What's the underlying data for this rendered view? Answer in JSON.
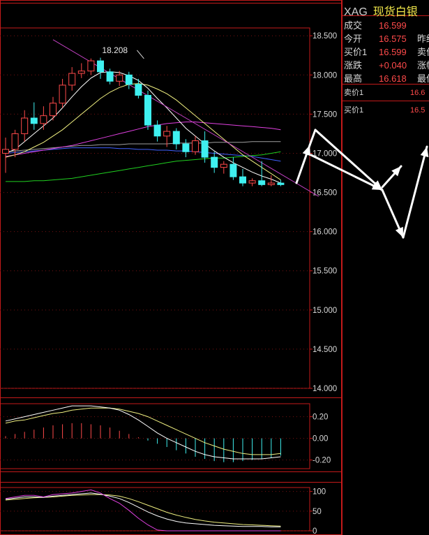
{
  "quote": {
    "code": "XAG",
    "name": "现货白银",
    "rows": [
      {
        "label": "成交",
        "value": "16.599",
        "label2": ""
      },
      {
        "label": "今开",
        "value": "16.575",
        "label2": "昨结"
      },
      {
        "label": "买价1",
        "value": "16.599",
        "label2": "卖价"
      },
      {
        "label": "涨跌",
        "value": "+0.040",
        "label2": "涨幅"
      },
      {
        "label": "最高",
        "value": "16.618",
        "label2": "最低"
      }
    ],
    "sell1": {
      "label": "卖价1",
      "value": "16.6"
    },
    "buy1": {
      "label": "买价1",
      "value": "16.5"
    }
  },
  "chart_data": [
    {
      "type": "candlestick",
      "panel": "main",
      "ylim": [
        14.0,
        18.6
      ],
      "y_ticks": [
        "18.500",
        "18.000",
        "17.500",
        "17.000",
        "16.500",
        "16.000",
        "15.500",
        "15.000",
        "14.500",
        "14.000"
      ],
      "y_tick_values": [
        18.5,
        18.0,
        17.5,
        17.0,
        16.5,
        16.0,
        15.5,
        15.0,
        14.5,
        14.0
      ],
      "annotation": {
        "text": "18.208",
        "index": 14,
        "value": 18.208
      },
      "colors": {
        "up": "#ff4a4a",
        "down": "#3ff0f0",
        "ma_short": "#ffffff",
        "ma_mid": "#f0f080",
        "ma_long1": "#e040e0",
        "ma_long2": "#4060ff",
        "ma_long3": "#20d020",
        "ma_long4": "#a0a0a0",
        "trend": "#c040c0"
      },
      "candles": [
        {
          "o": 17.0,
          "h": 17.2,
          "l": 16.75,
          "c": 17.05
        },
        {
          "o": 17.05,
          "h": 17.3,
          "l": 16.95,
          "c": 17.25
        },
        {
          "o": 17.25,
          "h": 17.55,
          "l": 17.15,
          "c": 17.45
        },
        {
          "o": 17.45,
          "h": 17.65,
          "l": 17.3,
          "c": 17.38
        },
        {
          "o": 17.38,
          "h": 17.6,
          "l": 17.3,
          "c": 17.48
        },
        {
          "o": 17.48,
          "h": 17.72,
          "l": 17.42,
          "c": 17.64
        },
        {
          "o": 17.64,
          "h": 17.95,
          "l": 17.58,
          "c": 17.87
        },
        {
          "o": 17.87,
          "h": 18.1,
          "l": 17.8,
          "c": 18.02
        },
        {
          "o": 18.02,
          "h": 18.15,
          "l": 17.96,
          "c": 18.05
        },
        {
          "o": 18.05,
          "h": 18.21,
          "l": 18.0,
          "c": 18.18
        },
        {
          "o": 18.18,
          "h": 18.22,
          "l": 17.95,
          "c": 18.04
        },
        {
          "o": 18.04,
          "h": 18.08,
          "l": 17.88,
          "c": 17.92
        },
        {
          "o": 17.92,
          "h": 18.05,
          "l": 17.86,
          "c": 18.0
        },
        {
          "o": 18.0,
          "h": 18.04,
          "l": 17.82,
          "c": 17.88
        },
        {
          "o": 17.88,
          "h": 17.95,
          "l": 17.7,
          "c": 17.74
        },
        {
          "o": 17.74,
          "h": 17.8,
          "l": 17.3,
          "c": 17.36
        },
        {
          "o": 17.36,
          "h": 17.42,
          "l": 17.15,
          "c": 17.22
        },
        {
          "o": 17.22,
          "h": 17.35,
          "l": 17.08,
          "c": 17.28
        },
        {
          "o": 17.28,
          "h": 17.32,
          "l": 17.05,
          "c": 17.12
        },
        {
          "o": 17.12,
          "h": 17.18,
          "l": 16.95,
          "c": 17.02
        },
        {
          "o": 17.02,
          "h": 17.22,
          "l": 16.98,
          "c": 17.16
        },
        {
          "o": 17.16,
          "h": 17.28,
          "l": 16.88,
          "c": 16.95
        },
        {
          "o": 16.95,
          "h": 17.02,
          "l": 16.75,
          "c": 16.82
        },
        {
          "o": 16.82,
          "h": 16.9,
          "l": 16.74,
          "c": 16.86
        },
        {
          "o": 16.86,
          "h": 16.95,
          "l": 16.66,
          "c": 16.7
        },
        {
          "o": 16.7,
          "h": 16.8,
          "l": 16.58,
          "c": 16.62
        },
        {
          "o": 16.62,
          "h": 16.68,
          "l": 16.58,
          "c": 16.65
        },
        {
          "o": 16.65,
          "h": 16.9,
          "l": 16.58,
          "c": 16.6
        },
        {
          "o": 16.6,
          "h": 16.72,
          "l": 16.58,
          "c": 16.62
        },
        {
          "o": 16.62,
          "h": 16.66,
          "l": 16.58,
          "c": 16.6
        }
      ],
      "ma_short": [
        17.0,
        17.05,
        17.15,
        17.25,
        17.35,
        17.45,
        17.58,
        17.72,
        17.85,
        17.96,
        18.03,
        18.04,
        18.03,
        17.99,
        17.93,
        17.83,
        17.7,
        17.58,
        17.45,
        17.32,
        17.22,
        17.12,
        17.03,
        16.95,
        16.88,
        16.82,
        16.76,
        16.71,
        16.67,
        16.62
      ],
      "ma_mid": [
        16.95,
        16.98,
        17.02,
        17.08,
        17.14,
        17.22,
        17.3,
        17.4,
        17.5,
        17.6,
        17.7,
        17.78,
        17.84,
        17.88,
        17.89,
        17.87,
        17.82,
        17.76,
        17.68,
        17.58,
        17.48,
        17.38,
        17.28,
        17.18,
        17.08,
        16.98,
        16.9,
        16.82,
        16.74,
        16.66
      ],
      "ma_long1": [
        16.96,
        16.98,
        17.0,
        17.02,
        17.04,
        17.06,
        17.08,
        17.1,
        17.13,
        17.16,
        17.19,
        17.22,
        17.25,
        17.28,
        17.31,
        17.34,
        17.36,
        17.38,
        17.39,
        17.4,
        17.4,
        17.39,
        17.38,
        17.37,
        17.36,
        17.35,
        17.34,
        17.33,
        17.32,
        17.3
      ],
      "ma_long2": [
        17.0,
        17.01,
        17.02,
        17.03,
        17.04,
        17.05,
        17.06,
        17.07,
        17.07,
        17.07,
        17.07,
        17.07,
        17.06,
        17.06,
        17.05,
        17.05,
        17.04,
        17.04,
        17.03,
        17.03,
        17.02,
        17.01,
        17.0,
        16.99,
        16.98,
        16.97,
        16.96,
        16.94,
        16.92,
        16.9
      ],
      "ma_long3": [
        16.64,
        16.64,
        16.64,
        16.65,
        16.65,
        16.66,
        16.67,
        16.68,
        16.7,
        16.72,
        16.74,
        16.76,
        16.78,
        16.8,
        16.82,
        16.84,
        16.86,
        16.88,
        16.9,
        16.91,
        16.92,
        16.93,
        16.94,
        16.94,
        16.95,
        16.96,
        16.97,
        16.98,
        17.0,
        17.02
      ],
      "ma_long4": [
        17.02,
        17.03,
        17.04,
        17.05,
        17.06,
        17.07,
        17.08,
        17.09,
        17.1,
        17.1,
        17.11,
        17.11,
        17.11,
        17.12,
        17.12,
        17.12,
        17.12,
        17.12,
        17.13,
        17.13,
        17.13,
        17.13,
        17.14,
        17.14,
        17.14,
        17.14,
        17.15,
        17.15,
        17.15,
        17.15
      ],
      "trend": {
        "from": {
          "index": 5,
          "value": 18.45
        },
        "to": {
          "index": 33,
          "value": 16.45
        }
      }
    },
    {
      "type": "macd",
      "panel": "macd",
      "ylim": [
        -0.28,
        0.32
      ],
      "y_ticks": [
        "0.20",
        "0.00",
        "-0.20"
      ],
      "y_tick_values": [
        0.2,
        0.0,
        -0.2
      ],
      "histogram": [
        0.02,
        0.04,
        0.06,
        0.08,
        0.1,
        0.12,
        0.13,
        0.14,
        0.14,
        0.13,
        0.12,
        0.1,
        0.07,
        0.04,
        0.01,
        -0.02,
        -0.05,
        -0.08,
        -0.11,
        -0.14,
        -0.17,
        -0.19,
        -0.21,
        -0.22,
        -0.22,
        -0.21,
        -0.2,
        -0.19,
        -0.18,
        -0.16
      ],
      "dif": [
        0.16,
        0.18,
        0.2,
        0.22,
        0.24,
        0.26,
        0.28,
        0.3,
        0.3,
        0.3,
        0.29,
        0.28,
        0.26,
        0.22,
        0.17,
        0.11,
        0.05,
        0.0,
        -0.04,
        -0.08,
        -0.12,
        -0.15,
        -0.17,
        -0.18,
        -0.19,
        -0.19,
        -0.19,
        -0.19,
        -0.18,
        -0.17
      ],
      "dea": [
        0.14,
        0.16,
        0.17,
        0.19,
        0.21,
        0.23,
        0.24,
        0.26,
        0.27,
        0.28,
        0.28,
        0.28,
        0.27,
        0.25,
        0.23,
        0.2,
        0.16,
        0.12,
        0.08,
        0.04,
        0.0,
        -0.04,
        -0.07,
        -0.1,
        -0.12,
        -0.14,
        -0.15,
        -0.15,
        -0.15,
        -0.14
      ]
    },
    {
      "type": "line",
      "panel": "kdj",
      "ylim": [
        0,
        110
      ],
      "y_ticks": [
        "100",
        "50",
        "0"
      ],
      "y_tick_values": [
        100,
        50,
        0
      ],
      "k": [
        80,
        83,
        86,
        86,
        85,
        88,
        90,
        92,
        94,
        96,
        93,
        88,
        82,
        72,
        60,
        48,
        38,
        30,
        24,
        20,
        18,
        16,
        14,
        13,
        12,
        11,
        11,
        11,
        10,
        10
      ],
      "d": [
        78,
        80,
        82,
        84,
        85,
        86,
        88,
        90,
        91,
        92,
        92,
        91,
        88,
        82,
        74,
        65,
        56,
        47,
        40,
        34,
        29,
        25,
        22,
        20,
        18,
        16,
        15,
        14,
        13,
        12
      ],
      "j": [
        82,
        86,
        90,
        90,
        86,
        92,
        94,
        96,
        100,
        104,
        96,
        82,
        70,
        52,
        32,
        15,
        2,
        0,
        0,
        0,
        0,
        0,
        0,
        0,
        0,
        0,
        0,
        0,
        0,
        0
      ]
    }
  ]
}
